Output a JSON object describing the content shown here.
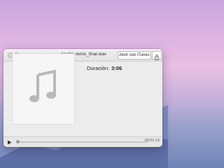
{
  "window": {
    "title": "kostra remix_final.wav",
    "open_button_label": "Abrir con iTunes",
    "share_icon": "share-icon",
    "close_icon": "close-icon",
    "minimize_icon": "minimize-icon"
  },
  "info": {
    "duration_label": "Duración:",
    "duration_value": "3:06"
  },
  "artwork": {
    "icon": "music-note-icon"
  },
  "player": {
    "play_icon": "play-icon",
    "progress": 0.0,
    "current_time": "00:01:13"
  }
}
